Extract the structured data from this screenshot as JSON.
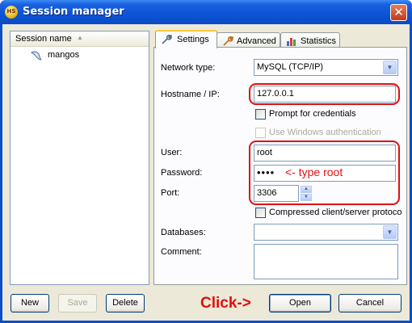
{
  "window": {
    "title": "Session manager",
    "app_icon_text": "HS",
    "close_icon": "close-x"
  },
  "sessions": {
    "column_header": "Session name",
    "items": [
      {
        "label": "mangos",
        "icon": "dolphin-icon"
      }
    ]
  },
  "left_buttons": {
    "new": "New",
    "save": "Save",
    "delete": "Delete"
  },
  "tabs": [
    {
      "label": "Settings",
      "icon": "wrench-icon",
      "active": true
    },
    {
      "label": "Advanced",
      "icon": "wrench-icon",
      "active": false
    },
    {
      "label": "Statistics",
      "icon": "bar-chart-icon",
      "active": false
    }
  ],
  "settings": {
    "network_type": {
      "label": "Network type:",
      "value": "MySQL (TCP/IP)"
    },
    "hostname": {
      "label": "Hostname / IP:",
      "value": "127.0.0.1"
    },
    "prompt_credentials": {
      "label": "Prompt for credentials",
      "checked": false
    },
    "windows_auth": {
      "label": "Use Windows authentication",
      "checked": false,
      "enabled": false
    },
    "user": {
      "label": "User:",
      "value": "root"
    },
    "password": {
      "label": "Password:",
      "value": "••••"
    },
    "port": {
      "label": "Port:",
      "value": "3306"
    },
    "compressed": {
      "label": "Compressed client/server protoco",
      "checked": false
    },
    "databases": {
      "label": "Databases:",
      "value": ""
    },
    "comment": {
      "label": "Comment:",
      "value": ""
    }
  },
  "annotations": {
    "password_hint": "<- type root",
    "click_hint": "Click->"
  },
  "footer_buttons": {
    "open": "Open",
    "cancel": "Cancel"
  },
  "colors": {
    "annotation": "#e01010",
    "titlebar": "#0c55d8",
    "dialog_bg": "#ece9d8"
  }
}
